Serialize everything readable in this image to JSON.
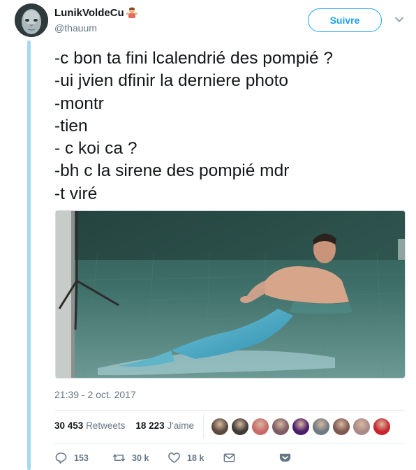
{
  "author": {
    "display_name": "LunikVoldeCu",
    "handle": "@thauum",
    "avatar_icon": "voldemort-avatar"
  },
  "header": {
    "follow_label": "Suivre",
    "menu_icon": "chevron-down-icon"
  },
  "tweet": {
    "lines": [
      "-c bon ta fini lcalendrié des pompié ?",
      "-ui jvien dfinir la derniere photo",
      "-montr",
      "-tien",
      "- c koi ca ?",
      "-bh c la sirene des pompié mdr",
      "-t viré"
    ],
    "media_description_icon": "photo-mermaid"
  },
  "meta": {
    "timestamp": "21:39 - 2 oct. 2017"
  },
  "stats": {
    "retweets_count": "30 453",
    "retweets_label": "Retweets",
    "likes_count": "18 223",
    "likes_label": "J'aime"
  },
  "likers": [
    {
      "color": "#5a4a3f"
    },
    {
      "color": "#3e3a36"
    },
    {
      "color": "#c86a6a"
    },
    {
      "color": "#7a5c64"
    },
    {
      "color": "#4a1c6b"
    },
    {
      "color": "#6e7b82"
    },
    {
      "color": "#7d5a52"
    },
    {
      "color": "#a88a86"
    },
    {
      "color": "#c9242e"
    }
  ],
  "actions": {
    "reply_count": "153",
    "retweet_count": "30 k",
    "like_count": "18 k"
  },
  "colors": {
    "brand_blue": "#1da1f2",
    "thread_line": "#a5d9f2",
    "secondary_text": "#657786"
  }
}
